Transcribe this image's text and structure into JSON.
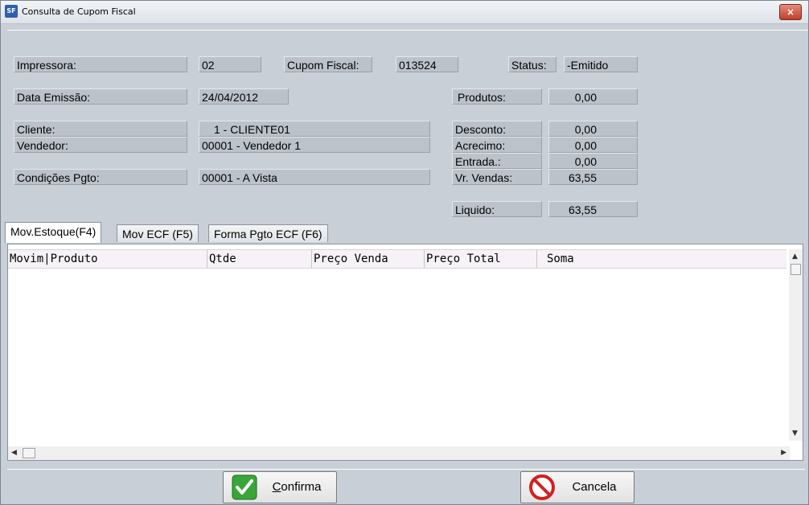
{
  "window": {
    "title": "Consulta de Cupom Fiscal",
    "icon": "SF",
    "close": "×"
  },
  "fields": {
    "impressora_label": "Impressora:",
    "impressora_value": "02",
    "cupom_label": "Cupom Fiscal:",
    "cupom_value": "013524",
    "status_label": "Status:",
    "status_value": "-Emitido",
    "data_label": "Data Emissão:",
    "data_value": "24/04/2012",
    "produtos_label": "Produtos:",
    "produtos_value": "0,00",
    "cliente_label": "Cliente:",
    "cliente_value": "1 - CLIENTE01",
    "vendedor_label": "Vendedor:",
    "vendedor_value": "00001 - Vendedor 1",
    "condicoes_label": "Condições Pgto:",
    "condicoes_value": "00001 - A Vista",
    "desconto_label": "Desconto:",
    "desconto_value": "0,00",
    "acrescimo_label": "Acrecimo:",
    "acrescimo_value": "0,00",
    "entrada_label": "Entrada.:",
    "entrada_value": "0,00",
    "vrvendas_label": "Vr. Vendas:",
    "vrvendas_value": "63,55",
    "liquido_label": "Liquido:",
    "liquido_value": "63,55"
  },
  "tabs": [
    {
      "label": "Mov.Estoque(F4)"
    },
    {
      "label": "Mov ECF (F5)"
    },
    {
      "label": "Forma Pgto ECF (F6)"
    }
  ],
  "grid": {
    "columns": [
      "Movim|Produto",
      "Qtde",
      "Preço Venda",
      "Preço Total",
      "Soma"
    ]
  },
  "buttons": {
    "confirm_label": "Confirma",
    "cancel_label": "Cancela"
  },
  "colors": {
    "confirm_icon": "#3aa63a",
    "cancel_icon": "#d22020"
  }
}
